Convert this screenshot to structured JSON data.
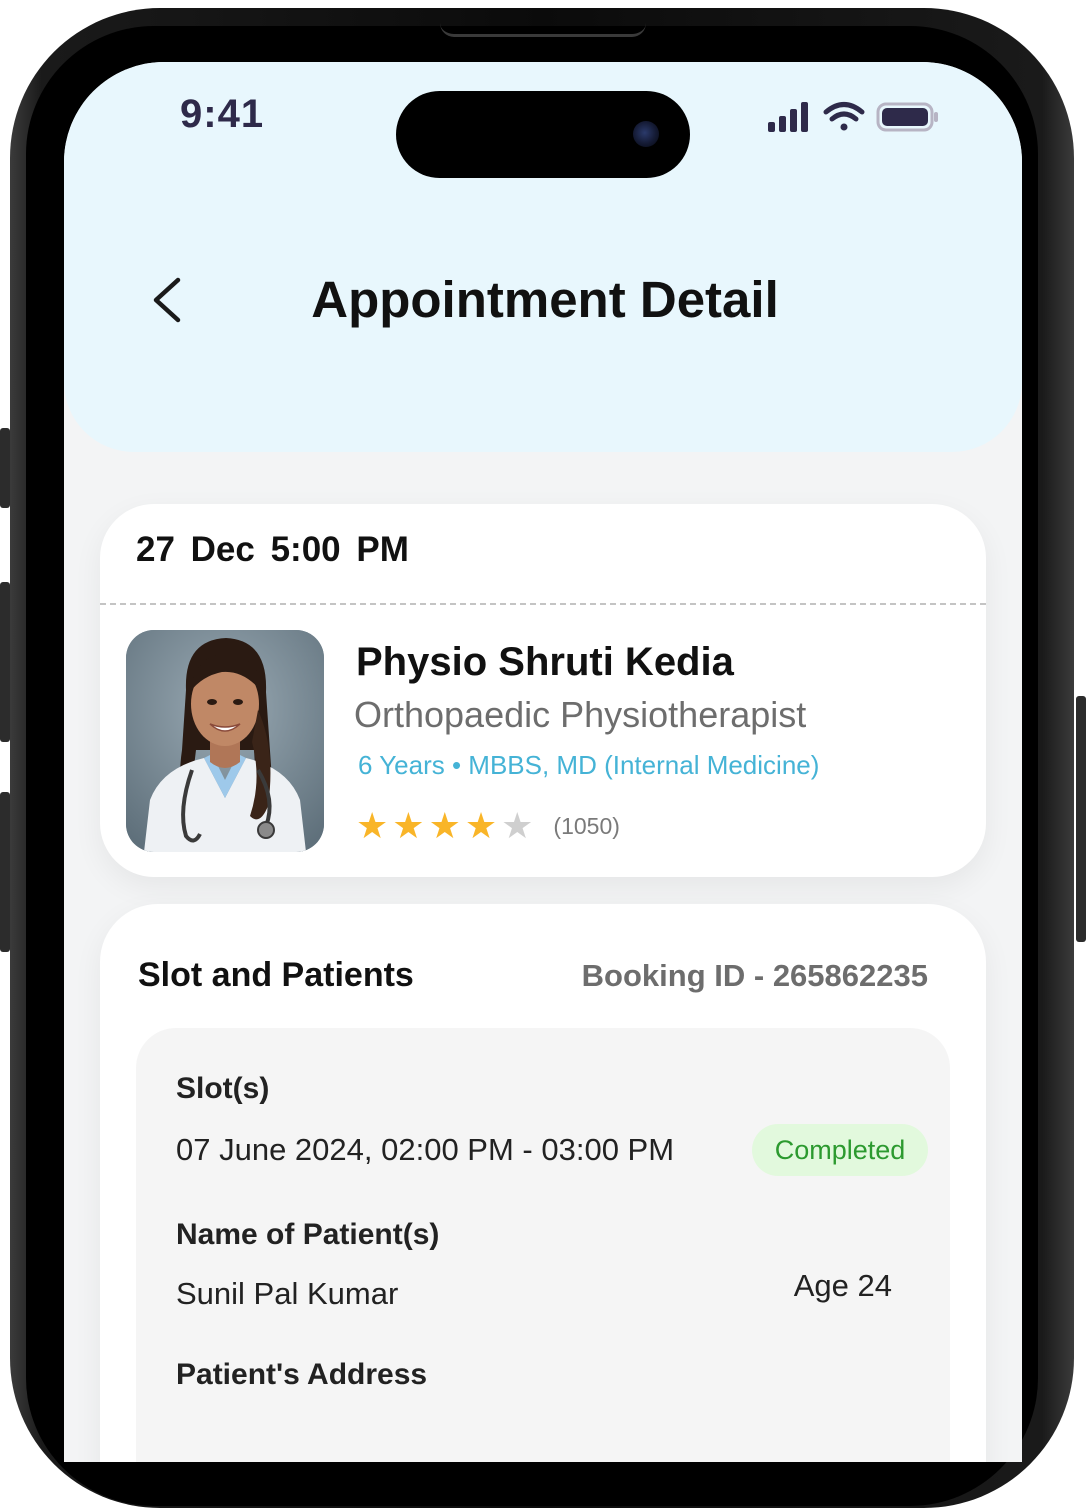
{
  "status_bar": {
    "time": "9:41"
  },
  "header": {
    "title": "Appointment Detail"
  },
  "appointment": {
    "datetime": "27 Dec  5:00 PM",
    "doctor": {
      "name": "Physio Shruti Kedia",
      "specialty": "Orthopaedic Physiotherapist",
      "qualifications": "6 Years • MBBS, MD (Internal Medicine)",
      "rating": 4,
      "rating_max": 5,
      "review_count": "(1050)"
    }
  },
  "slot_section": {
    "heading": "Slot and Patients",
    "booking_id": "Booking ID - 265862235",
    "slot_label": "Slot(s)",
    "slot_value": "07 June 2024, 02:00 PM - 03:00 PM",
    "status": "Completed",
    "patient_label": "Name of Patient(s)",
    "patient_name": "Sunil Pal Kumar",
    "patient_age": "Age 24",
    "address_label": "Patient's Address"
  },
  "colors": {
    "header_bg": "#e8f7fd",
    "accent_blue": "#45b3d6",
    "star_gold": "#f9b528",
    "status_green": "#2c9a2f",
    "status_green_bg": "#e2f9dd"
  },
  "icons": {
    "back": "chevron-left-icon",
    "signal": "cellular-signal-icon",
    "wifi": "wifi-icon",
    "battery": "battery-icon",
    "star": "star-icon"
  }
}
